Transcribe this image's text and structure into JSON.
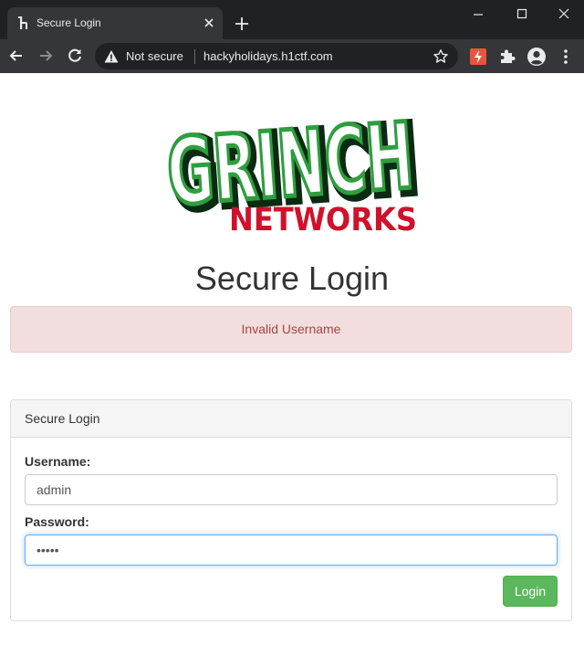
{
  "browser": {
    "tab_title": "Secure Login",
    "security_label": "Not secure",
    "url": "hackyholidays.h1ctf.com"
  },
  "logo": {
    "top_text": "GRINCH",
    "bottom_text": "NETWORKS",
    "colors": {
      "green": "#2e9e3e",
      "dark": "#0b2a12",
      "red": "#d0112b"
    }
  },
  "page": {
    "title": "Secure Login",
    "alert": "Invalid Username"
  },
  "form": {
    "panel_heading": "Secure Login",
    "username_label": "Username:",
    "username_value": "admin",
    "password_label": "Password:",
    "password_value": "*****",
    "submit_label": "Login"
  },
  "colors": {
    "alert_bg": "#f2dede",
    "alert_text": "#a94442",
    "button": "#5cb85c",
    "focus": "#66afe9"
  }
}
